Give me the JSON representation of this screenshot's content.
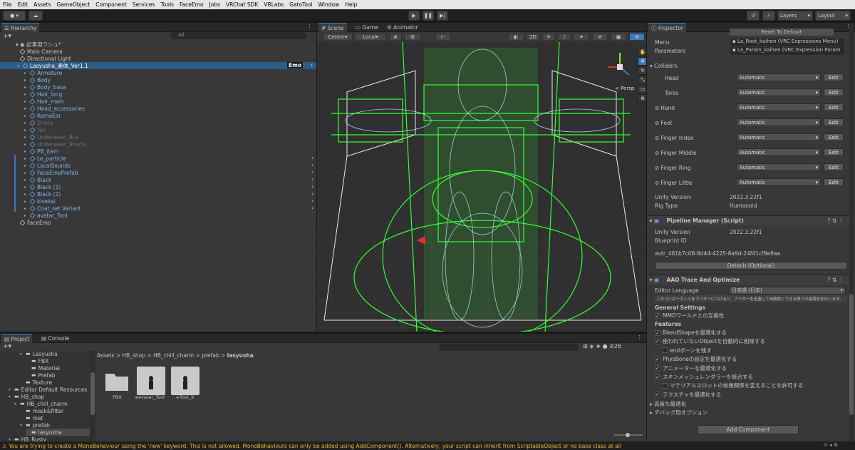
{
  "menubar": {
    "items": [
      "File",
      "Edit",
      "Assets",
      "GameObject",
      "Component",
      "Services",
      "Tools",
      "FaceEmo",
      "Jobs",
      "VRChat SDK",
      "VRLabs",
      "GatoTool",
      "Window",
      "Help"
    ]
  },
  "toolbar": {
    "layers": "Layers",
    "layout": "Layout"
  },
  "hierarchy": {
    "tab": "Hierarchy",
    "search_placeholder": "All",
    "scene": "記事用ラシュ*",
    "selected_badge": "Emo",
    "rows": [
      {
        "label": "Main Camera",
        "style": "normal"
      },
      {
        "label": "Directional Light",
        "style": "normal"
      },
      {
        "label": "Lasyusha_素体_Ver1.1",
        "style": "selected"
      },
      {
        "label": "Armature",
        "style": "blue"
      },
      {
        "label": "Body",
        "style": "blue"
      },
      {
        "label": "Body_base",
        "style": "blue"
      },
      {
        "label": "Hair_long",
        "style": "blue"
      },
      {
        "label": "Hair_main",
        "style": "blue"
      },
      {
        "label": "Head_accessories",
        "style": "blue"
      },
      {
        "label": "KemoEar",
        "style": "blue"
      },
      {
        "label": "Shose",
        "style": "gray"
      },
      {
        "label": "Tail",
        "style": "gray"
      },
      {
        "label": "Underwear_Bra",
        "style": "gray"
      },
      {
        "label": "Underwear_Shorts",
        "style": "gray"
      },
      {
        "label": "PB_item",
        "style": "blue"
      },
      {
        "label": "Le_particle",
        "style": "blue"
      },
      {
        "label": "LocalSounds",
        "style": "blue"
      },
      {
        "label": "FaceEmoPrefab",
        "style": "blue"
      },
      {
        "label": "Black",
        "style": "blue"
      },
      {
        "label": "Black (1)",
        "style": "blue"
      },
      {
        "label": "Black (2)",
        "style": "blue"
      },
      {
        "label": "kisekai",
        "style": "blue"
      },
      {
        "label": "Coat_set Variant",
        "style": "blue"
      },
      {
        "label": "avatar_Tool",
        "style": "blue"
      },
      {
        "label": "FaceEmo",
        "style": "normal"
      }
    ]
  },
  "scene": {
    "tabs": [
      "Scene",
      "Game",
      "Animator"
    ],
    "pivot": "Center",
    "space": "Local",
    "mode2d": "2D",
    "persp": "< Persp"
  },
  "inspector": {
    "tab": "Inspector",
    "reset_btn": "Reset To Default",
    "menu_label": "Menu",
    "menu_value": "La_Root_kaihen (VRC Expressions Menu)",
    "params_label": "Parameters",
    "params_value": "La_Param_kaihen (VRC Expression Param",
    "colliders_header": "Colliders",
    "colliders": [
      {
        "name": "Head",
        "value": "Automatic",
        "edit": "Edit"
      },
      {
        "name": "Torso",
        "value": "Automatic",
        "edit": "Edit"
      },
      {
        "name": "Hand",
        "value": "Automatic",
        "edit": "Edit"
      },
      {
        "name": "Foot",
        "value": "Automatic",
        "edit": "Edit"
      },
      {
        "name": "Finger Index",
        "value": "Automatic",
        "edit": "Edit"
      },
      {
        "name": "Finger Middle",
        "value": "Automatic",
        "edit": "Edit"
      },
      {
        "name": "Finger Ring",
        "value": "Automatic",
        "edit": "Edit"
      },
      {
        "name": "Finger Little",
        "value": "Automatic",
        "edit": "Edit"
      }
    ],
    "unity_version_label": "Unity Version:",
    "unity_version": "2022.3.22f1",
    "rig_label": "Rig Type:",
    "rig_value": "Humanoid",
    "pipeline_title": "Pipeline Manager (Script)",
    "pm_unity_label": "Unity Version",
    "pm_unity_value": "2022.3.22f1",
    "blueprint_label": "Blueprint ID",
    "blueprint_value": "avtr_461b7c08-8d44-4225-8a9d-24f41cf9e9aa",
    "detach_btn": "Detach (Optional)",
    "aao_title": "AAO Trace And Optimize",
    "lang_label": "Editor Language",
    "lang_value": "日本語 (日本)",
    "aao_desc": "このコンポーネントをアバターにつけると、アバターを走査して自動的にできる限りの最適化を行います。",
    "general_header": "General Settings",
    "general_items": [
      {
        "label": "MMDワールドとの互換性",
        "checked": true
      }
    ],
    "features_header": "Features",
    "feature_items": [
      {
        "label": "BlendShapeを最適化する",
        "checked": true,
        "indent": 0
      },
      {
        "label": "使われていないObjectを自動的に削除する",
        "checked": true,
        "indent": 0
      },
      {
        "label": "endボーンを残す",
        "checked": false,
        "indent": 1
      },
      {
        "label": "PhysBoneの設定を最適化する",
        "checked": true,
        "indent": 0
      },
      {
        "label": "アニメーターを最適化する",
        "checked": true,
        "indent": 0
      },
      {
        "label": "スキンメッシュレンダラーを統合する",
        "checked": true,
        "indent": 0
      },
      {
        "label": "マテリアルスロットの前後関係を変えることを許可する",
        "checked": false,
        "indent": 1
      },
      {
        "label": "テクスチャを最適化する",
        "checked": true,
        "indent": 0
      }
    ],
    "advanced": "高度な最適化",
    "debug": "デバッグ用オプション",
    "add_component": "Add Component"
  },
  "project": {
    "tabs": [
      "Project",
      "Console"
    ],
    "count": "26",
    "breadcrumb": [
      "Assets",
      "HB_shop",
      "HB_chill_charm",
      "prefab",
      "lasyusha"
    ],
    "tree": [
      {
        "label": "Lasyusha",
        "indent": 3
      },
      {
        "label": "FBX",
        "indent": 4
      },
      {
        "label": "Material",
        "indent": 4
      },
      {
        "label": "Prefab",
        "indent": 4
      },
      {
        "label": "Texture",
        "indent": 3
      },
      {
        "label": "Editor Default Resources",
        "indent": 1
      },
      {
        "label": "HB_shop",
        "indent": 1
      },
      {
        "label": "HB_chill_charm",
        "indent": 2
      },
      {
        "label": "mask&filter",
        "indent": 3
      },
      {
        "label": "mat",
        "indent": 3
      },
      {
        "label": "prefab",
        "indent": 3
      },
      {
        "label": "lasyusha",
        "indent": 4
      },
      {
        "label": "HB_Rusty",
        "indent": 1
      }
    ],
    "assets": [
      {
        "label": "FBX"
      },
      {
        "label": "avatar_Tool"
      },
      {
        "label": "Tool_X"
      }
    ]
  },
  "status": {
    "warning": "You are trying to create a MonoBehaviour using the 'new' keyword.  This is not allowed.  MonoBehaviours can only be added using AddComponent(). Alternatively, your script can inherit from ScriptableObject or no base class at all"
  }
}
